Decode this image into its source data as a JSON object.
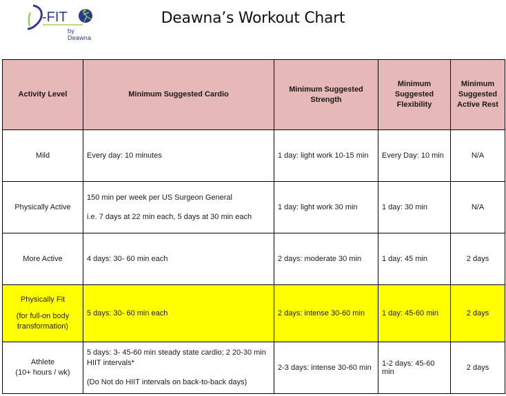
{
  "logo": {
    "brand_text": "D-FIT",
    "byline": "by Deawna",
    "colors": {
      "primary": "#2b3990",
      "accent": "#8dc63f"
    }
  },
  "title": "Deawna’s Workout Chart",
  "table": {
    "header_color": "#e6b8b7",
    "highlight_color": "#ffff00",
    "columns": [
      "Activity Level",
      "Minimum Suggested Cardio",
      "Minimum Suggested Strength",
      "Minimum Suggested Flexibility",
      "Minimum Suggested Active Rest"
    ],
    "rows": [
      {
        "level": "Mild",
        "level_note": "",
        "cardio": [
          "Every day: 10 minutes"
        ],
        "strength": "1 day: light work 10-15 min",
        "flexibility": "Every Day: 10 min",
        "active_rest": "N/A"
      },
      {
        "level": "Physically Active",
        "level_note": "",
        "cardio": [
          "150 min per week per US Surgeon General",
          "i.e. 7 days at 22 min each, 5 days at 30 min each"
        ],
        "strength": "1 day: light work 30 min",
        "flexibility": "1 day: 30 min",
        "active_rest": "N/A"
      },
      {
        "level": "More Active",
        "level_note": "",
        "cardio": [
          "4 days: 30- 60 min each"
        ],
        "strength": "2 days: moderate 30 min",
        "flexibility": "1 day: 45 min",
        "active_rest": "2 days"
      },
      {
        "level": "Physically Fit",
        "level_note": "(for full-on body transformation)",
        "highlighted": true,
        "cardio": [
          "5 days: 30- 60 min each"
        ],
        "strength": "2 days: intense 30-60 min",
        "flexibility": "1 day: 45-60 min",
        "active_rest": "2 days"
      },
      {
        "level": "Athlete",
        "level_note": "(10+ hours / wk)",
        "cardio": [
          "5 days: 3- 45-60 min steady state cardio; 2 20-30 min HIIT intervals*",
          "(Do Not do HIIT intervals on back-to-back days)"
        ],
        "strength": "2-3 days: intense 30-60 min",
        "flexibility": "1-2 days: 45-60 min",
        "active_rest": "2 days"
      }
    ]
  }
}
